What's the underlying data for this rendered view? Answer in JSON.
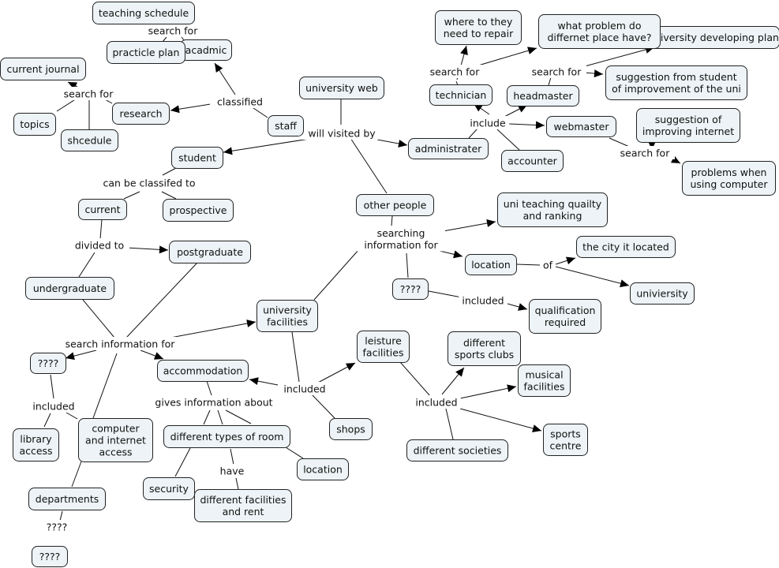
{
  "diagram": {
    "type": "concept-map",
    "nodes": {
      "teaching_schedule": "teaching schedule",
      "uni_developing_plan": "university developing plan",
      "acadmic": "acadmic",
      "practicle_plan": "practicle plan",
      "current_journal": "current journal",
      "research": "research",
      "topics": "topics",
      "shcedule": "shcedule",
      "staff": "staff",
      "university_web": "university web",
      "student": "student",
      "current": "current",
      "prospective": "prospective",
      "postgraduate": "postgraduate",
      "undergraduate": "undergraduate",
      "where_repair": [
        "where to they",
        "need to repair"
      ],
      "what_problem": [
        "what problem do",
        "differnet place have?"
      ],
      "technician": "technician",
      "headmaster": "headmaster",
      "suggestion_student": [
        "suggestion from student",
        "of improvement of the uni"
      ],
      "webmaster": "webmaster",
      "administrater": "administrater",
      "accounter": "accounter",
      "suggestion_internet": [
        "suggestion of",
        "improving internet"
      ],
      "problems_computer": [
        "problems when",
        "using computer"
      ],
      "other_people": "other people",
      "uni_teaching": [
        "uni teaching quailty",
        "and ranking"
      ],
      "city_located": "the city it located",
      "location_top": "location",
      "univiersity": "univiersity",
      "qqqq_mid": "????",
      "qualification": [
        "qualification",
        "required"
      ],
      "university_facilities": [
        "university",
        "facilities"
      ],
      "leisure_facilities": [
        "leisture",
        "facilities"
      ],
      "sports_clubs": [
        "different",
        "sports clubs"
      ],
      "musical": [
        "musical",
        "facilities"
      ],
      "sports_centre": [
        "sports",
        "centre"
      ],
      "societies": "different societies",
      "shops": "shops",
      "accommodation": "accommodation",
      "types_room": "different types of room",
      "location_room": "location",
      "security": "security",
      "facilities_rent": [
        "different facilities",
        "and rent"
      ],
      "qqqq_left": "????",
      "library": [
        "library",
        "access"
      ],
      "computer_internet": [
        "computer",
        "and internet",
        "access"
      ],
      "departments": "departments",
      "qqqq_bottom": "????"
    },
    "link_labels": {
      "search_for_top": "search for",
      "search_for_left": "search for",
      "classified": "classified",
      "will_visited_by": "will visited by",
      "can_be_classified": "can be classifed to",
      "divided_to": "divided to",
      "search_for_tech": "search for",
      "search_for_head": "search for",
      "include": "include",
      "search_for_web": "search for",
      "searching_info": [
        "searching",
        "information for"
      ],
      "of": "of",
      "included_qual": "included",
      "search_info_for": "search information for",
      "included_uf": "included",
      "included_leisure": "included",
      "gives_info": "gives information about",
      "have": "have",
      "included_lib": "included",
      "qqqq_dept": "????"
    }
  }
}
